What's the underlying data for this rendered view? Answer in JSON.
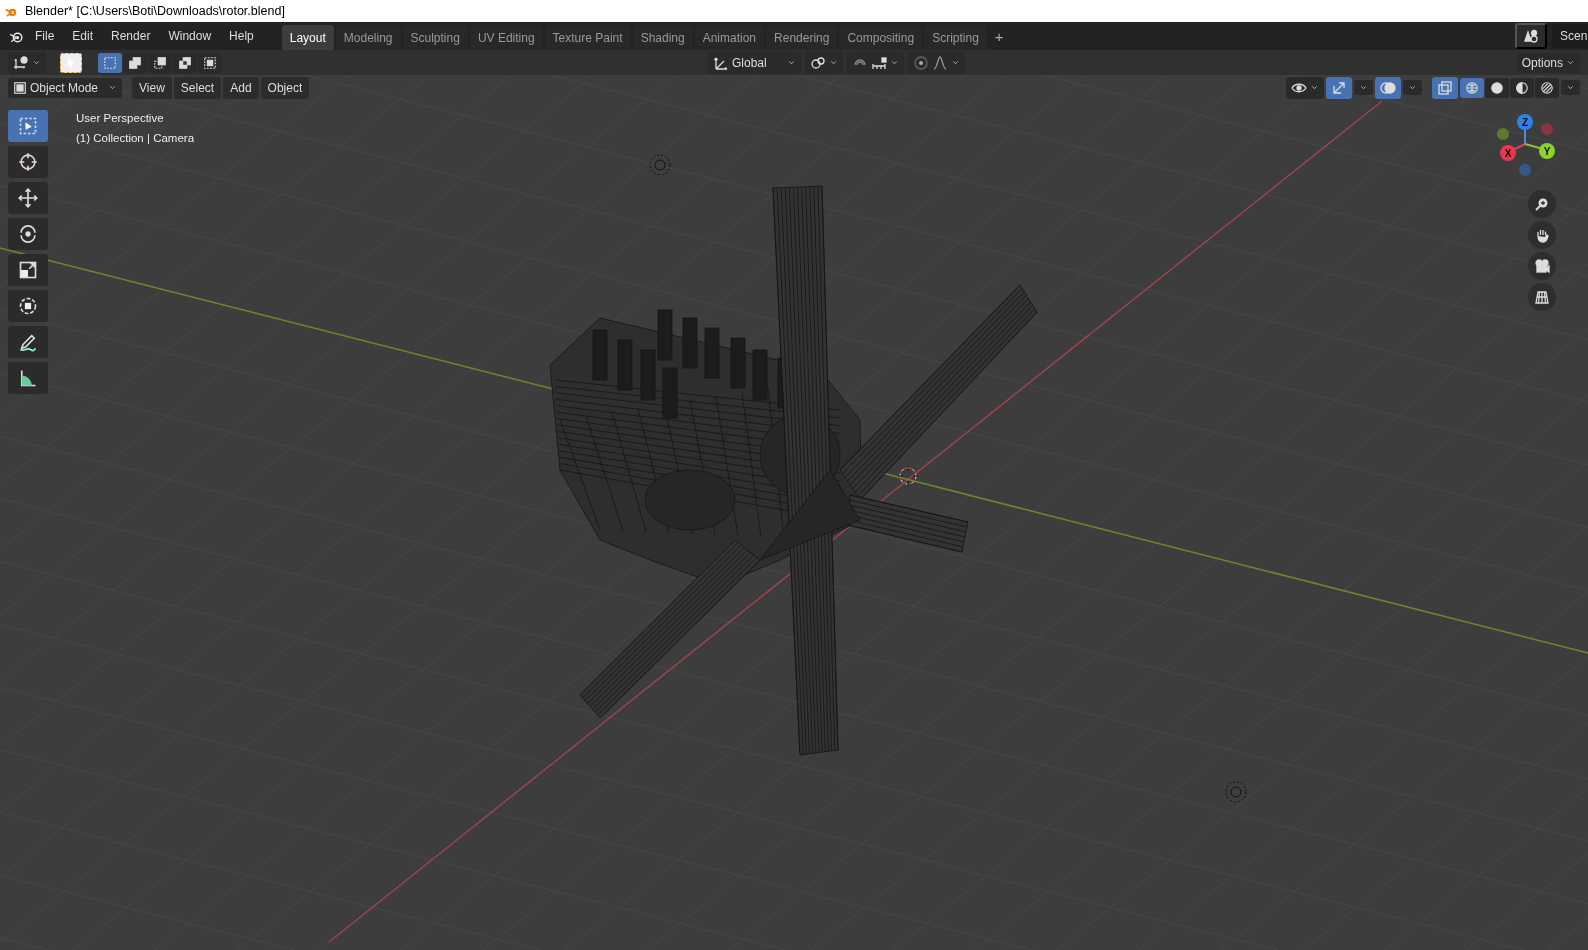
{
  "window": {
    "title": "Blender* [C:\\Users\\Boti\\Downloads\\rotor.blend]"
  },
  "menu": [
    "File",
    "Edit",
    "Render",
    "Window",
    "Help"
  ],
  "workspaces": [
    {
      "label": "Layout",
      "selected": true
    },
    {
      "label": "Modeling",
      "selected": false
    },
    {
      "label": "Sculpting",
      "selected": false
    },
    {
      "label": "UV Editing",
      "selected": false
    },
    {
      "label": "Texture Paint",
      "selected": false
    },
    {
      "label": "Shading",
      "selected": false
    },
    {
      "label": "Animation",
      "selected": false
    },
    {
      "label": "Rendering",
      "selected": false
    },
    {
      "label": "Compositing",
      "selected": false
    },
    {
      "label": "Scripting",
      "selected": false
    }
  ],
  "add_workspace": "+",
  "scene": "Scen",
  "tool_header": {
    "select_modes": [
      {
        "selected": true
      },
      {
        "selected": false
      },
      {
        "selected": false
      },
      {
        "selected": false
      },
      {
        "selected": false
      }
    ],
    "orientation": "Global",
    "options": "Options"
  },
  "viewport_header": {
    "mode": "Object Mode",
    "menus": [
      "View",
      "Select",
      "Add",
      "Object"
    ],
    "gizmos": true,
    "overlays": true,
    "xray": true,
    "shading": [
      {
        "selected": true
      },
      {
        "selected": false
      },
      {
        "selected": false
      },
      {
        "selected": false
      }
    ]
  },
  "overlay_text": [
    "User Perspective",
    "(1) Collection | Camera"
  ],
  "toolbar": [
    {
      "kind": "select",
      "selected": true
    },
    {
      "kind": "cursor",
      "selected": false
    },
    {
      "kind": "move",
      "selected": false
    },
    {
      "kind": "rotate",
      "selected": false
    },
    {
      "kind": "scale",
      "selected": false
    },
    {
      "kind": "transform",
      "selected": false
    },
    {
      "kind": "annotate",
      "selected": false
    },
    {
      "kind": "measure",
      "selected": false
    }
  ],
  "navigation_gizmo": {
    "axes": [
      "Z",
      "X",
      "Y"
    ]
  }
}
